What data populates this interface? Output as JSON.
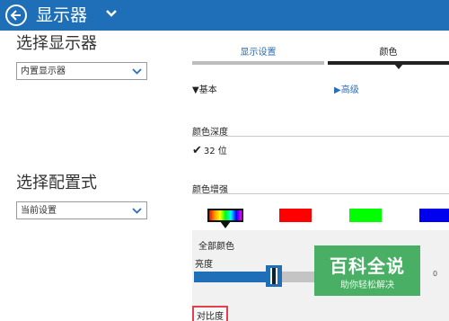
{
  "titlebar": {
    "title": "显示器"
  },
  "left": {
    "choose_display_heading": "选择显示器",
    "display_select_value": "内置显示器",
    "choose_profile_heading": "选择配置式",
    "profile_select_value": "当前设置"
  },
  "tabs": [
    {
      "label": "显示设置",
      "active": false
    },
    {
      "label": "颜色",
      "active": true
    }
  ],
  "mode": {
    "basic_label": "▼基本",
    "advanced_label": "▶高级"
  },
  "color_depth": {
    "title": "颜色深度",
    "value": "32 位"
  },
  "color_enhance": {
    "title": "颜色增强",
    "swatches": [
      "all-colors",
      "red",
      "green",
      "blue"
    ],
    "selected_swatch": "all-colors"
  },
  "panel": {
    "all_colors_label": "全部颜色",
    "brightness_label": "亮度",
    "brightness_value": "0",
    "brightness_level_fraction": 0.66,
    "contrast_label": "对比度"
  },
  "watermark": {
    "title": "百科全说",
    "subtitle": "助你轻松解决"
  },
  "colors": {
    "accent": "#1f6fb8",
    "highlight_border": "#e0414c",
    "watermark_bg": "#3caa5a"
  }
}
